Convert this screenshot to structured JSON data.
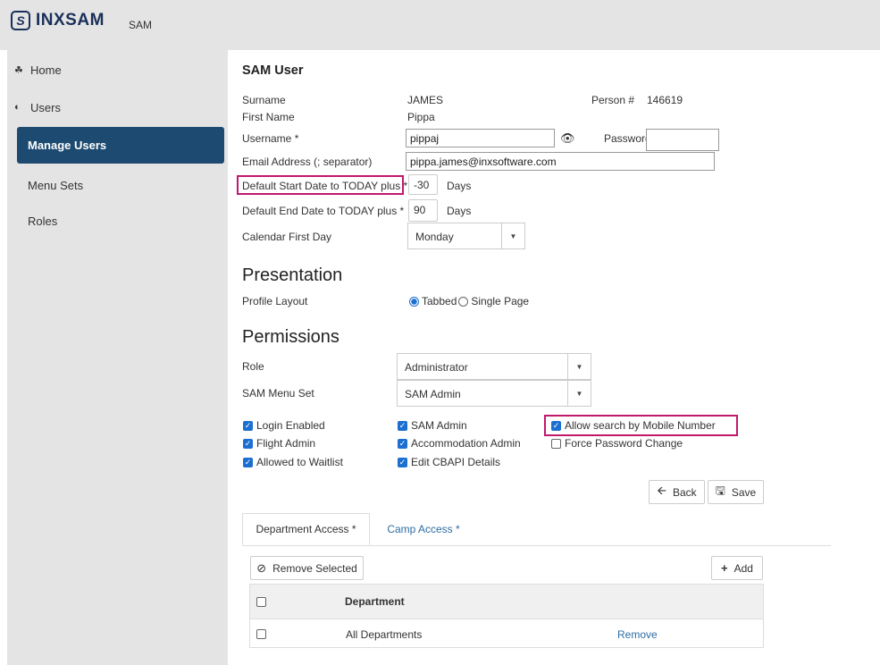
{
  "header": {
    "logo_letter": "S",
    "logo_text": "INXSAM",
    "app_name": "SAM"
  },
  "sidebar": {
    "items": [
      {
        "label": "Home",
        "icon": "home-icon"
      },
      {
        "label": "Users",
        "icon": "circle-arrow-icon"
      },
      {
        "label": "Manage Users"
      },
      {
        "label": "Menu Sets"
      },
      {
        "label": "Roles"
      }
    ]
  },
  "form": {
    "title": "SAM User",
    "surname_label": "Surname",
    "surname_value": "JAMES",
    "person_label": "Person #",
    "person_value": "146619",
    "firstname_label": "First Name",
    "firstname_value": "Pippa",
    "username_label": "Username *",
    "username_value": "pippaj",
    "password_label": "Password *",
    "password_value": "",
    "email_label": "Email Address (; separator)",
    "email_value": "pippa.james@inxsoftware.com",
    "start_label": "Default Start Date to TODAY plus *",
    "start_value": "-30",
    "start_unit": "Days",
    "end_label": "Default End Date to TODAY plus *",
    "end_value": "90",
    "end_unit": "Days",
    "calendar_label": "Calendar First Day",
    "calendar_value": "Monday"
  },
  "presentation": {
    "title": "Presentation",
    "profile_label": "Profile Layout",
    "option_tabbed": "Tabbed",
    "option_single": "Single Page",
    "selected": "Tabbed"
  },
  "permissions": {
    "title": "Permissions",
    "role_label": "Role",
    "role_value": "Administrator",
    "menuset_label": "SAM Menu Set",
    "menuset_value": "SAM Admin",
    "checks": [
      {
        "label": "Login Enabled",
        "checked": true
      },
      {
        "label": "Flight Admin",
        "checked": true
      },
      {
        "label": "Allowed to Waitlist",
        "checked": true
      },
      {
        "label": "SAM Admin",
        "checked": true
      },
      {
        "label": "Accommodation Admin",
        "checked": true
      },
      {
        "label": "Edit CBAPI Details",
        "checked": true
      },
      {
        "label": "Allow search by Mobile Number",
        "checked": true
      },
      {
        "label": "Force Password Change",
        "checked": false
      }
    ]
  },
  "actions": {
    "back_label": "Back",
    "save_label": "Save"
  },
  "tabs": [
    {
      "label": "Department Access *",
      "active": true
    },
    {
      "label": "Camp Access *",
      "active": false
    }
  ],
  "dept": {
    "remove_selected_label": "Remove Selected",
    "add_label": "Add",
    "column_header": "Department",
    "rows": [
      {
        "name": "All Departments",
        "action": "Remove"
      }
    ]
  },
  "colors": {
    "accent": "#1c4a70",
    "highlight": "#c2186b",
    "link": "#2e6da4",
    "checkbox": "#1c6fd1"
  }
}
